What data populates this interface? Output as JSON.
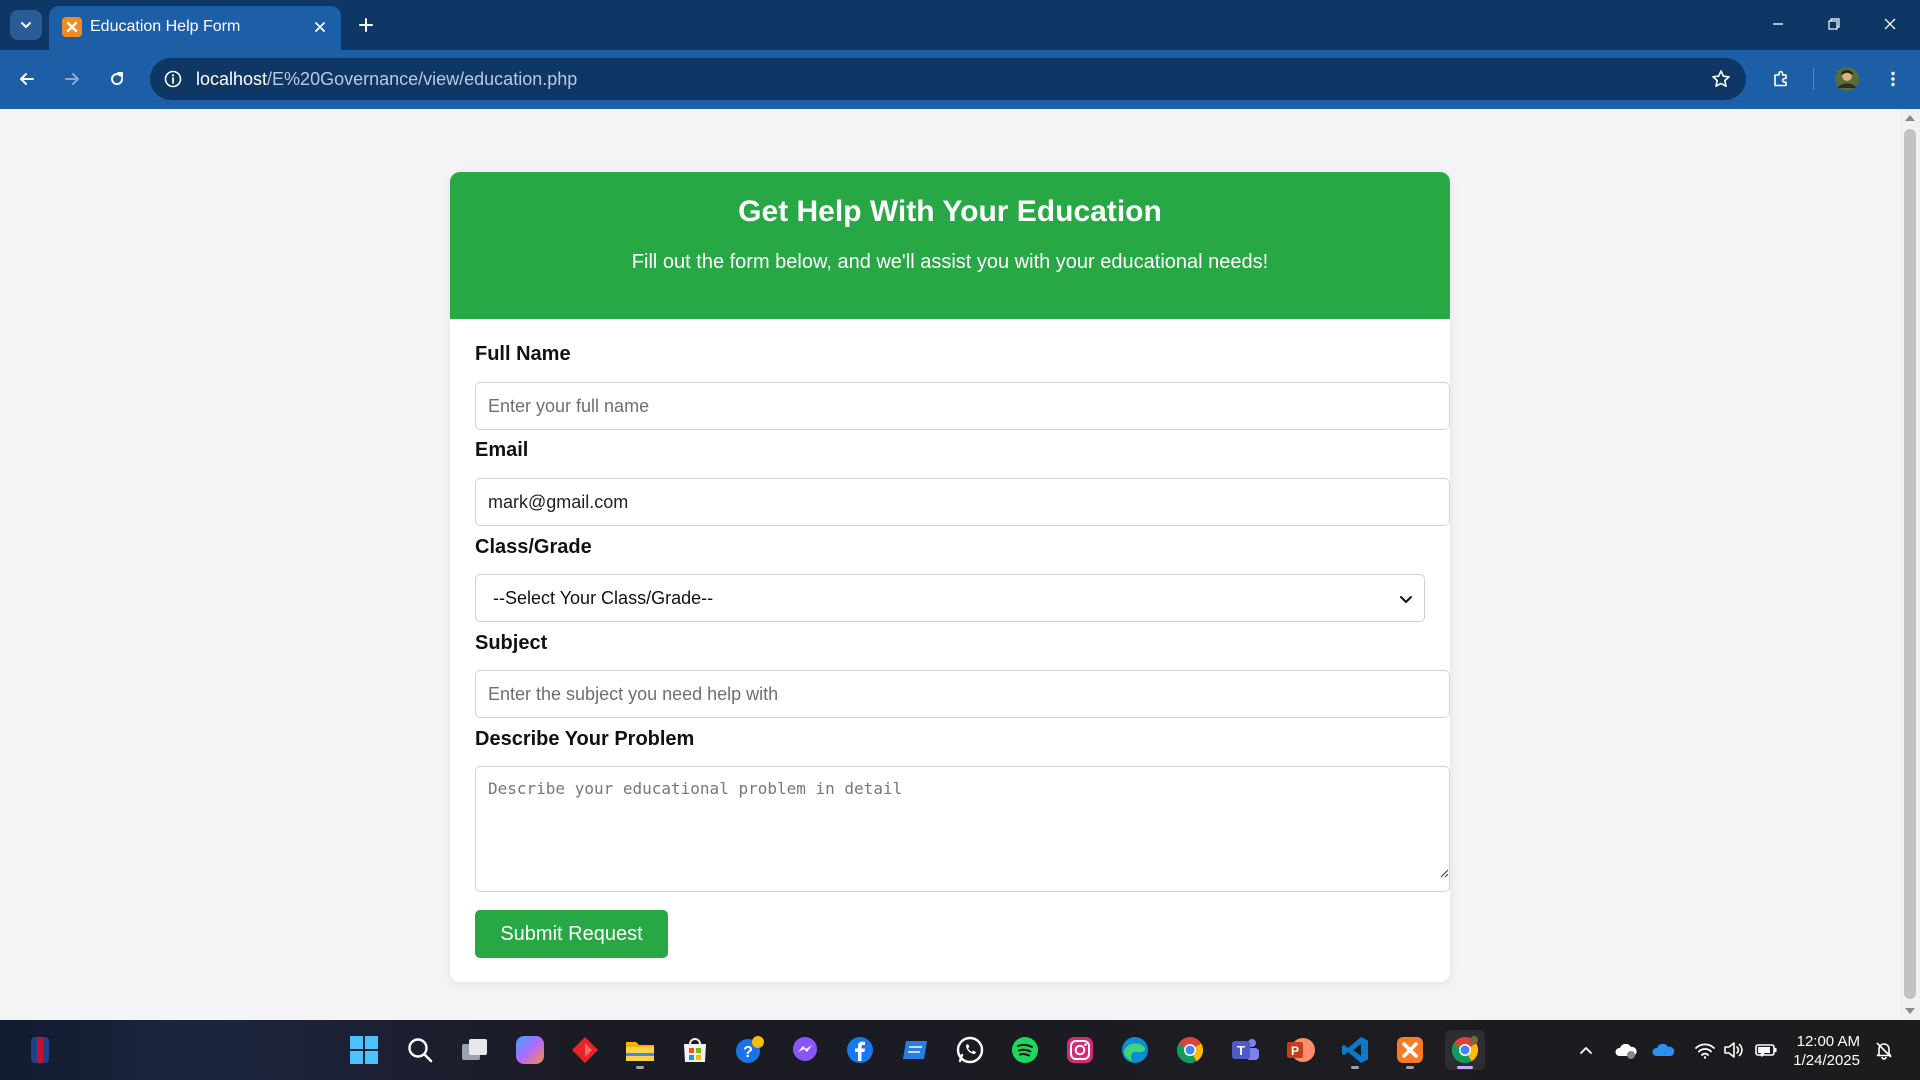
{
  "browser": {
    "tab_title": "Education Help Form",
    "url_host": "localhost",
    "url_path": "/E%20Governance/view/education.php"
  },
  "page": {
    "header": {
      "title": "Get Help With Your Education",
      "subtitle": "Fill out the form below, and we'll assist you with your educational needs!"
    },
    "form": {
      "full_name": {
        "label": "Full Name",
        "placeholder": "Enter your full name",
        "value": ""
      },
      "email": {
        "label": "Email",
        "value": "mark@gmail.com"
      },
      "class_grade": {
        "label": "Class/Grade",
        "selected": "--Select Your Class/Grade--"
      },
      "subject": {
        "label": "Subject",
        "placeholder": "Enter the subject you need help with",
        "value": ""
      },
      "problem": {
        "label": "Describe Your Problem",
        "placeholder": "Describe your educational problem in detail"
      },
      "submit_label": "Submit Request"
    }
  },
  "taskbar": {
    "time": "12:00 AM",
    "date": "1/24/2025",
    "apps": [
      "start",
      "search",
      "task-view",
      "copilot",
      "app-red",
      "file-explorer",
      "microsoft-store",
      "help",
      "messenger",
      "facebook",
      "app-blue",
      "whatsapp",
      "spotify",
      "instagram",
      "edge",
      "chrome",
      "teams",
      "powerpoint",
      "vscode",
      "xampp",
      "chrome-active"
    ]
  },
  "colors": {
    "accent_green": "#28a745",
    "chrome_dark": "#0f3766",
    "chrome_toolbar": "#1c5fa7",
    "page_bg": "#f4f4f6"
  }
}
